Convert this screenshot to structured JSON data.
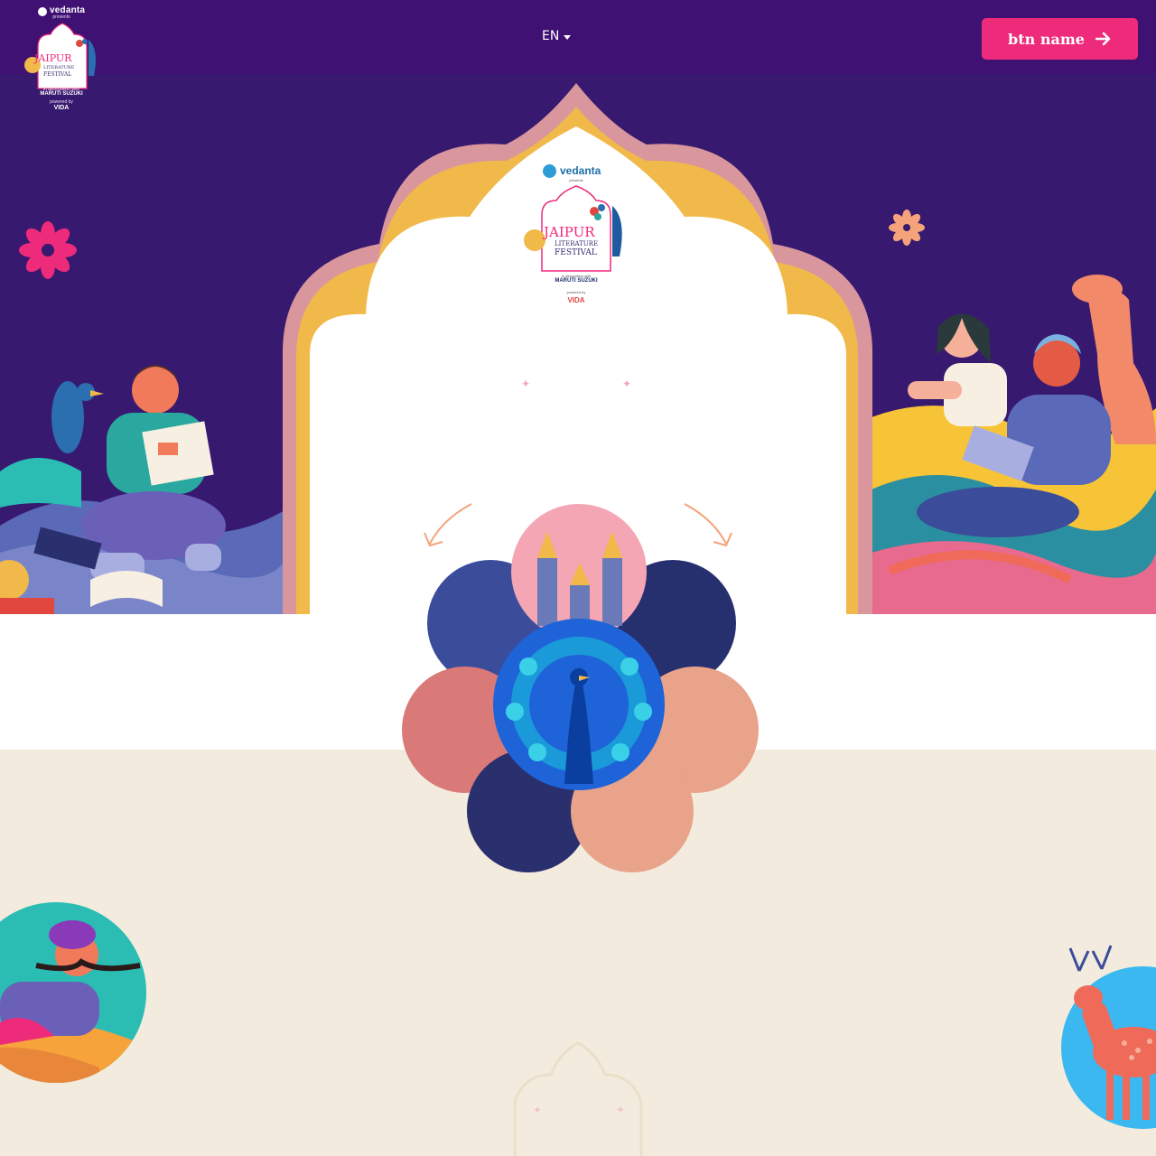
{
  "header": {
    "logo": {
      "sponsor": "vedanta",
      "sponsor_sub": "presents",
      "title_line1": "JAIPUR",
      "title_line2": "LITERATURE",
      "title_line3": "FESTIVAL",
      "co_sponsor_sub": "in association with",
      "co_sponsor": "MARUTI SUZUKI",
      "powered_sub": "powered by",
      "powered": "VIDA"
    },
    "language": {
      "selected": "EN",
      "icon": "caret-down-icon"
    },
    "cta": {
      "label": "btn name",
      "icon": "arrow-right-icon"
    }
  },
  "hero": {
    "center_logo": {
      "sponsor": "vedanta",
      "sponsor_sub": "presents",
      "title_line1": "JAIPUR",
      "title_line2": "LITERATURE",
      "title_line3": "FESTIVAL",
      "co_sponsor_sub": "in association with",
      "co_sponsor": "MARUTI SUZUKI",
      "powered_sub": "powered by",
      "powered": "VIDA"
    }
  },
  "colors": {
    "header_bg": "#3f1173",
    "hero_bg": "#37196f",
    "cta_bg": "#ee2a7b",
    "arch_outer": "#d9969c",
    "arch_inner": "#f0b94a",
    "cream": "#f3ebdd"
  }
}
